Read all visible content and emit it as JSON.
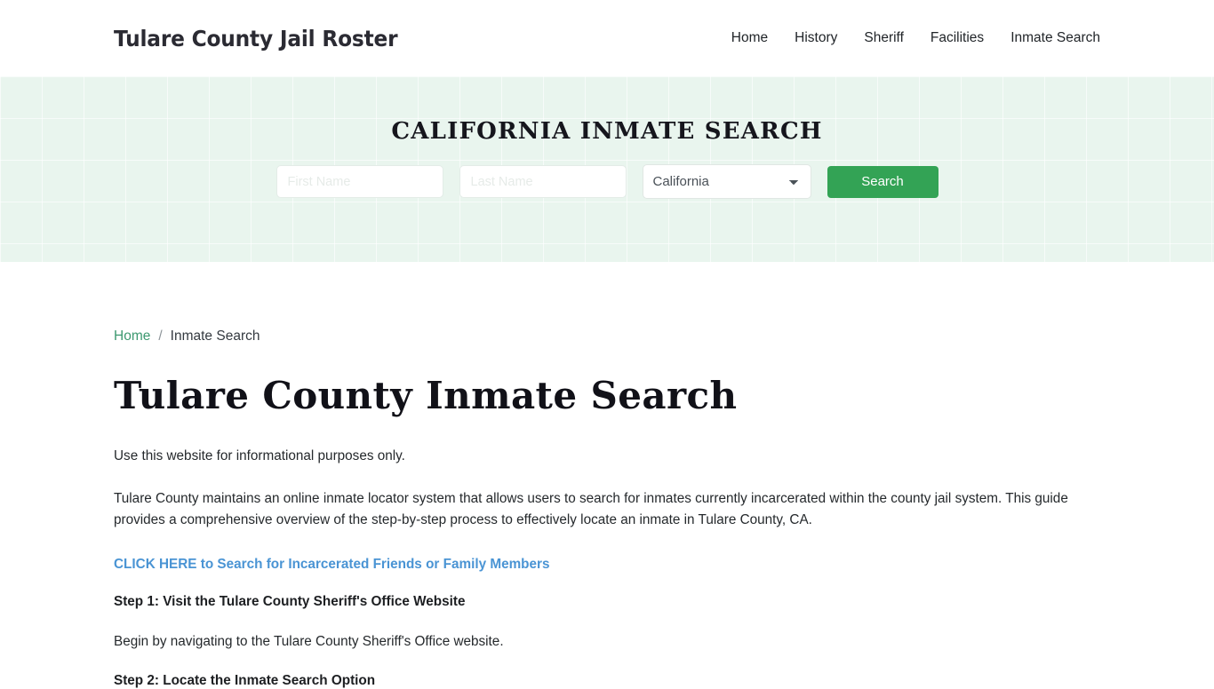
{
  "header": {
    "brand": "Tulare County Jail Roster",
    "nav": [
      {
        "label": "Home"
      },
      {
        "label": "History"
      },
      {
        "label": "Sheriff"
      },
      {
        "label": "Facilities"
      },
      {
        "label": "Inmate Search"
      }
    ]
  },
  "hero": {
    "title": "CALIFORNIA INMATE SEARCH",
    "background_color": "#e9f5ee",
    "form": {
      "first_name": {
        "value": "",
        "placeholder": "First Name"
      },
      "last_name": {
        "value": "",
        "placeholder": "Last Name"
      },
      "state": {
        "selected": "California",
        "options": [
          "California"
        ]
      },
      "search_label": "Search",
      "search_color": "#33a355"
    }
  },
  "breadcrumb": {
    "home": "Home",
    "separator": "/",
    "current": "Inmate Search",
    "link_color": "#3d9970"
  },
  "main": {
    "page_title": "Tulare County Inmate Search",
    "intro": "Use this website for informational purposes only.",
    "overview": "Tulare County maintains an online inmate locator system that allows users to search for inmates currently incarcerated within the county jail system. This guide provides a comprehensive overview of the step-by-step process to effectively locate an inmate in Tulare County, CA.",
    "cta_link": "CLICK HERE to Search for Incarcerated Friends or Family Members",
    "cta_color": "#4a94d4",
    "step1_heading": "Step 1: Visit the Tulare County Sheriff's Office Website",
    "step1_body": "Begin by navigating to the Tulare County Sheriff's Office website.",
    "step2_heading": "Step 2: Locate the Inmate Search Option"
  }
}
